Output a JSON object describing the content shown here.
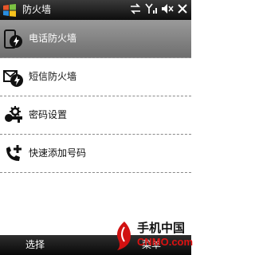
{
  "title_bar": {
    "title": "防火墙",
    "icons": [
      "windows-start-icon",
      "sync-arrows-icon",
      "signal-icon",
      "speaker-muted-icon",
      "close-icon"
    ]
  },
  "menu": {
    "items": [
      {
        "label": "电话防火墙",
        "icon": "phone-shield-icon",
        "selected": true
      },
      {
        "label": "短信防火墙",
        "icon": "sms-shield-icon",
        "selected": false
      },
      {
        "label": "密码设置",
        "icon": "key-gear-icon",
        "selected": false
      },
      {
        "label": "快速添加号码",
        "icon": "phone-add-icon",
        "selected": false
      }
    ]
  },
  "softkeys": {
    "left": "选择",
    "right": "菜单"
  },
  "watermark": {
    "line1": "手机中国",
    "line2": "CNMO.com"
  },
  "colors": {
    "selection": "#8a8a8a",
    "bar": "#1a1a1a",
    "brand_red": "#d11111"
  }
}
